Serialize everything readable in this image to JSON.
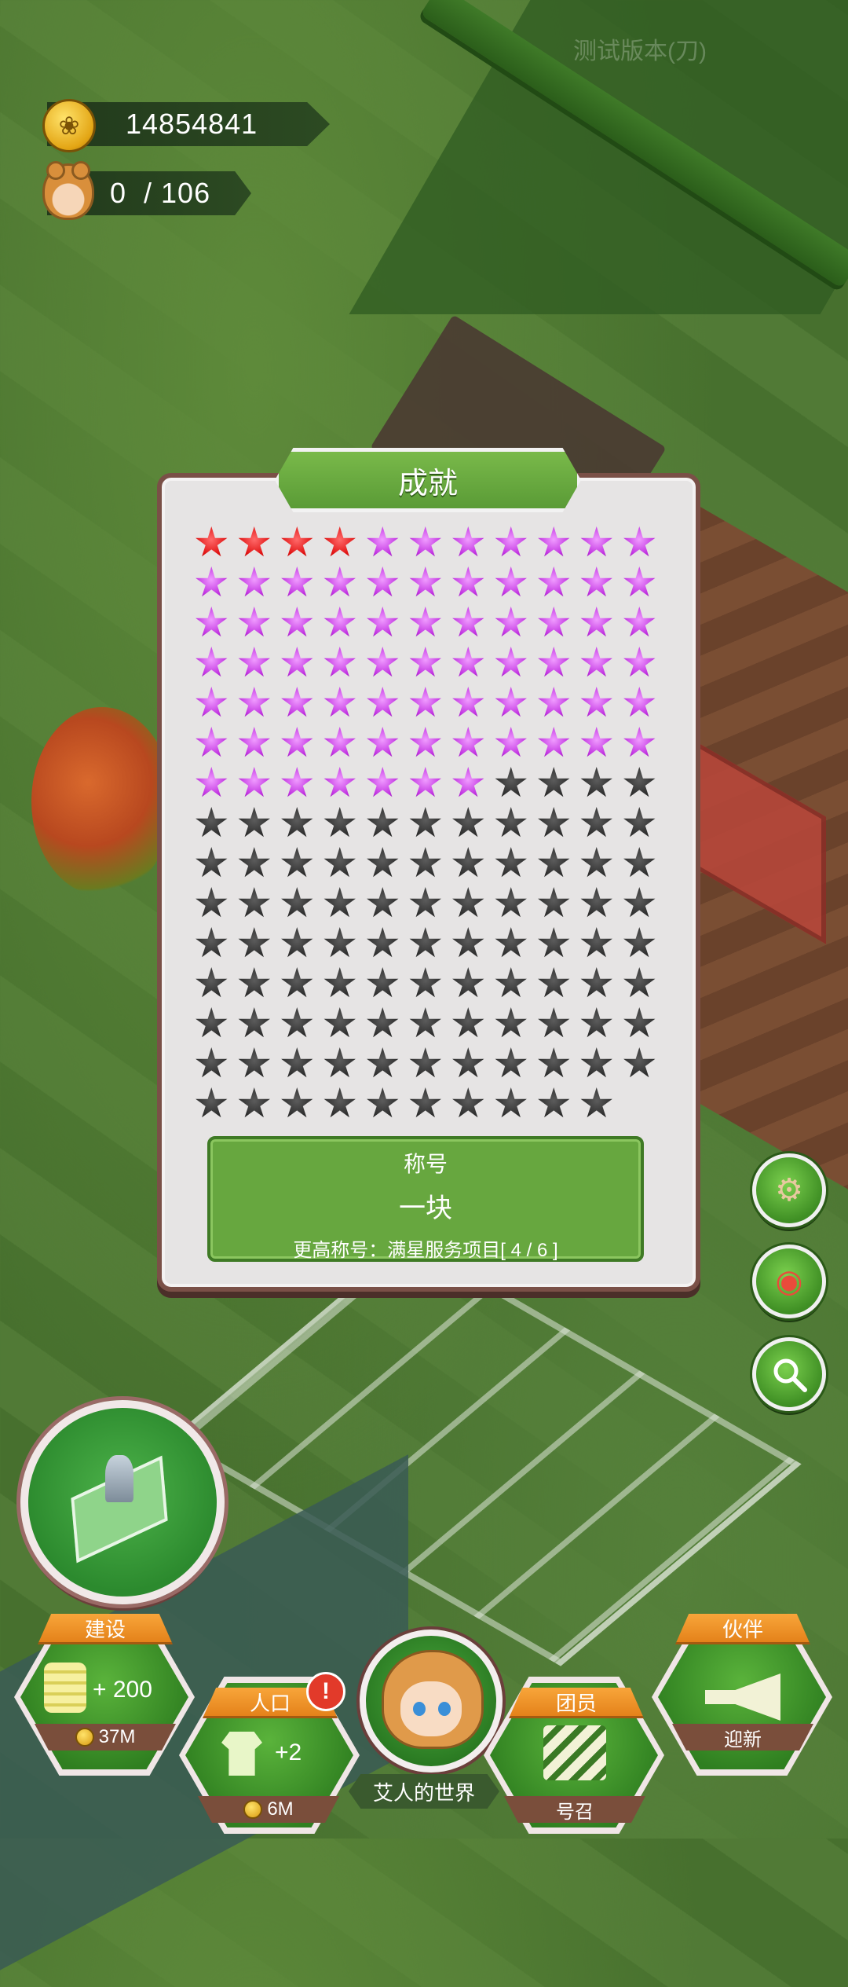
{
  "hud": {
    "coins": "14854841",
    "population_current": "0",
    "population_max": "/ 106",
    "watermark": "测试版本(刀)"
  },
  "achievement_panel": {
    "title": "成就",
    "stars": {
      "total_slots": 164,
      "red": 4,
      "purple": 69,
      "dark": 91,
      "colors": {
        "red": "#e01212",
        "purple": "#c031e0",
        "dark": "#2e2e2e"
      }
    },
    "rank": {
      "label": "称号",
      "name": "一块",
      "next_label": "更高称号：满星服务项目[ 4 / 6 ]"
    }
  },
  "side_buttons": [
    {
      "name": "settings",
      "icon": "gear-icon"
    },
    {
      "name": "screenshot",
      "icon": "camera-icon"
    },
    {
      "name": "search",
      "icon": "magnifier-icon"
    }
  ],
  "bottom_bar": {
    "build": {
      "tag": "建设",
      "value": "+ 200",
      "cost": "37M"
    },
    "population": {
      "tag": "人口",
      "value": "+2",
      "cost": "6M",
      "alert": "!"
    },
    "world": {
      "label": "艾人的世界"
    },
    "team": {
      "tag": "团员",
      "action": "号召"
    },
    "partner": {
      "tag": "伙伴",
      "action": "迎新"
    }
  },
  "colors": {
    "accent_green": "#5a9b36",
    "panel_border": "#7a5047",
    "tag_orange": "#f8a53a"
  }
}
